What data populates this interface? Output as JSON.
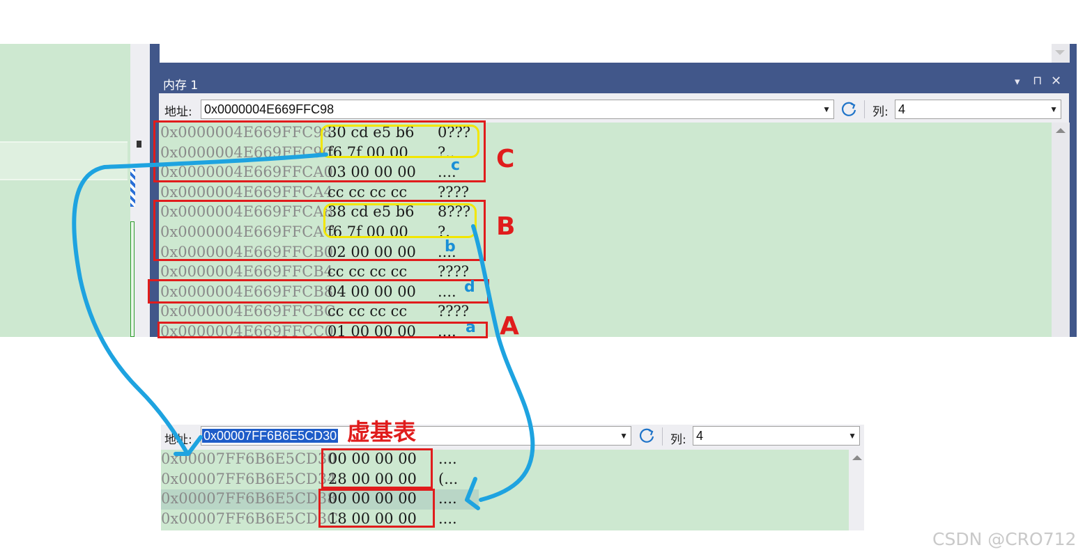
{
  "top_window": {
    "title": "内存 1",
    "title_buttons": [
      "▾",
      "⊓",
      "✕"
    ],
    "address_label": "地址:",
    "address_value": "0x0000004E669FFC98",
    "columns_label": "列:",
    "columns_value": "4",
    "rows": [
      {
        "addr": "0x0000004E669FFC98",
        "hex": "30 cd e5 b6",
        "ascii": "0???"
      },
      {
        "addr": "0x0000004E669FFC9C",
        "hex": "f6 7f 00 00",
        "ascii": "?.."
      },
      {
        "addr": "0x0000004E669FFCA0",
        "hex": "03 00 00 00",
        "ascii": "...."
      },
      {
        "addr": "0x0000004E669FFCA4",
        "hex": "cc cc cc cc",
        "ascii": "????"
      },
      {
        "addr": "0x0000004E669FFCA8",
        "hex": "38 cd e5 b6",
        "ascii": "8???"
      },
      {
        "addr": "0x0000004E669FFCAC",
        "hex": "f6 7f 00 00",
        "ascii": "?."
      },
      {
        "addr": "0x0000004E669FFCB0",
        "hex": "02 00 00 00",
        "ascii": "...."
      },
      {
        "addr": "0x0000004E669FFCB4",
        "hex": "cc cc cc cc",
        "ascii": "????"
      },
      {
        "addr": "0x0000004E669FFCB8",
        "hex": "04 00 00 00",
        "ascii": "...."
      },
      {
        "addr": "0x0000004E669FFCBC",
        "hex": "cc cc cc cc",
        "ascii": "????"
      },
      {
        "addr": "0x0000004E669FFCC0",
        "hex": "01 00 00 00",
        "ascii": "...."
      }
    ]
  },
  "bottom_window": {
    "address_label": "地址:",
    "address_value": "0x00007FF6B6E5CD30",
    "columns_label": "列:",
    "columns_value": "4",
    "rows": [
      {
        "addr": "0x00007FF6B6E5CD30",
        "hex": "00 00 00 00",
        "ascii": "...."
      },
      {
        "addr": "0x00007FF6B6E5CD34",
        "hex": "28 00 00 00",
        "ascii": "(..."
      },
      {
        "addr": "0x00007FF6B6E5CD38",
        "hex": "00 00 00 00",
        "ascii": "...."
      },
      {
        "addr": "0x00007FF6B6E5CD3C",
        "hex": "18 00 00 00",
        "ascii": "...."
      }
    ]
  },
  "annotations": {
    "label_A": "A",
    "label_B": "B",
    "label_C": "C",
    "label_a": "a",
    "label_b": "b",
    "label_c": "c",
    "label_d": "d",
    "vbase_table": "虚基表"
  },
  "watermark": "CSDN @CRO712",
  "colors": {
    "editor_bg": "#cde8d0",
    "titlebar": "#3f5b8f",
    "annotation_red": "#e01c1c",
    "annotation_yellow": "#f2e600",
    "arrow_blue": "#1ea3e0"
  },
  "icons": {
    "refresh": "refresh-icon",
    "dropdown": "chevron-down-icon",
    "pin": "pin-icon",
    "close": "close-icon",
    "scroll_up": "scroll-up-icon"
  }
}
